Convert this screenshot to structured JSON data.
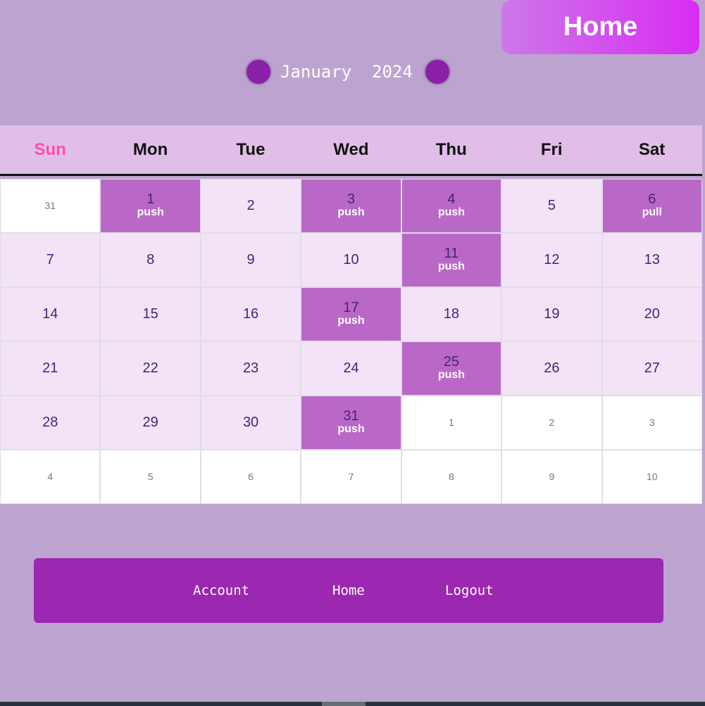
{
  "header": {
    "home_label": "Home"
  },
  "calendar": {
    "month": "January",
    "year": "2024",
    "weekdays": [
      "Sun",
      "Mon",
      "Tue",
      "Wed",
      "Thu",
      "Fri",
      "Sat"
    ],
    "cells": [
      {
        "day": "31",
        "other": true
      },
      {
        "day": "1",
        "tag": "push"
      },
      {
        "day": "2"
      },
      {
        "day": "3",
        "tag": "push"
      },
      {
        "day": "4",
        "tag": "push"
      },
      {
        "day": "5"
      },
      {
        "day": "6",
        "tag": "pull"
      },
      {
        "day": "7"
      },
      {
        "day": "8"
      },
      {
        "day": "9"
      },
      {
        "day": "10"
      },
      {
        "day": "11",
        "tag": "push"
      },
      {
        "day": "12"
      },
      {
        "day": "13"
      },
      {
        "day": "14"
      },
      {
        "day": "15"
      },
      {
        "day": "16"
      },
      {
        "day": "17",
        "tag": "push"
      },
      {
        "day": "18"
      },
      {
        "day": "19"
      },
      {
        "day": "20"
      },
      {
        "day": "21"
      },
      {
        "day": "22"
      },
      {
        "day": "23"
      },
      {
        "day": "24"
      },
      {
        "day": "25",
        "tag": "push"
      },
      {
        "day": "26"
      },
      {
        "day": "27"
      },
      {
        "day": "28"
      },
      {
        "day": "29"
      },
      {
        "day": "30"
      },
      {
        "day": "31",
        "tag": "push"
      },
      {
        "day": "1",
        "other": true
      },
      {
        "day": "2",
        "other": true
      },
      {
        "day": "3",
        "other": true
      },
      {
        "day": "4",
        "other": true
      },
      {
        "day": "5",
        "other": true
      },
      {
        "day": "6",
        "other": true
      },
      {
        "day": "7",
        "other": true
      },
      {
        "day": "8",
        "other": true
      },
      {
        "day": "9",
        "other": true
      },
      {
        "day": "10",
        "other": true
      }
    ]
  },
  "footer": {
    "links": [
      "Account",
      "Home",
      "Logout"
    ]
  },
  "colors": {
    "background": "#bda4d0",
    "event_cell": "#ba68c8",
    "footer": "#9c27b0",
    "sunday": "#ff4db0"
  }
}
